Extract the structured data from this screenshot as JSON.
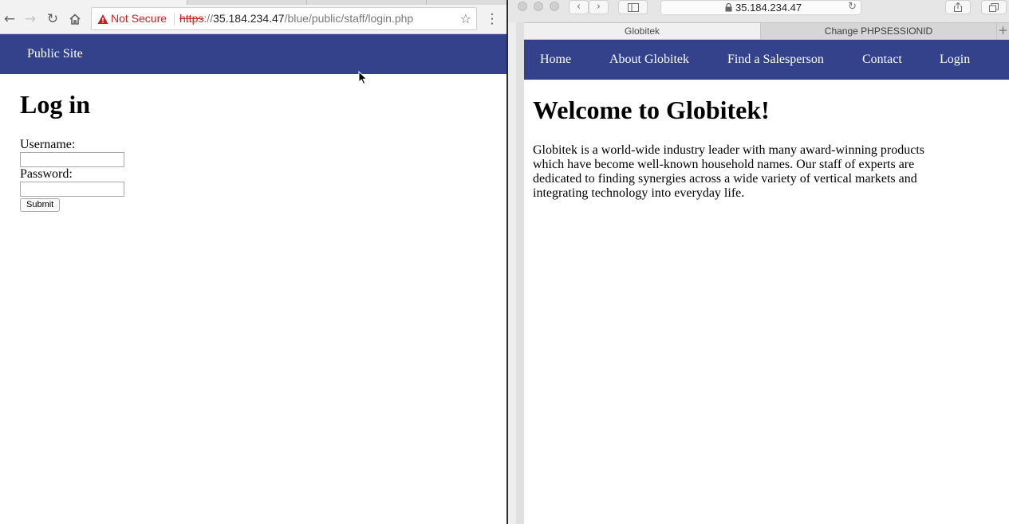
{
  "left_browser": {
    "security_label": "Not Secure",
    "url_scheme": "https",
    "url_sep": "://",
    "url_host": "35.184.234.47",
    "url_path": "/blue/public/staff/login.php",
    "nav": {
      "public_site": "Public Site"
    },
    "page": {
      "heading": "Log in",
      "username_label": "Username:",
      "password_label": "Password:",
      "submit_label": "Submit"
    }
  },
  "right_browser": {
    "address": "35.184.234.47",
    "tabs": [
      "Globitek",
      "Change PHPSESSIONID"
    ],
    "tab_add": "+",
    "nav": [
      "Home",
      "About Globitek",
      "Find a Salesperson",
      "Contact",
      "Login"
    ],
    "page": {
      "heading": "Welcome to Globitek!",
      "intro": "Globitek is a world-wide industry leader with many award-winning products which have become well-known household names. Our staff of experts are dedicated to finding synergies across a wide variety of vertical markets and integrating technology into everyday life."
    }
  },
  "colors": {
    "nav_bar": "#33428a",
    "warning_red": "#c5221f"
  },
  "icons": [
    "back-arrow-icon",
    "forward-arrow-icon",
    "reload-icon",
    "home-icon",
    "warning-triangle-icon",
    "bookmark-star-icon",
    "menu-dots-icon",
    "sidebar-icon",
    "lock-icon",
    "share-icon",
    "tabs-overview-icon",
    "mouse-cursor-icon"
  ]
}
